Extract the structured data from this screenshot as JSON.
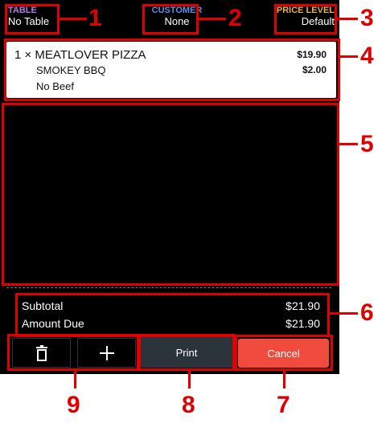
{
  "header": {
    "table_label": "TABLE",
    "table_value": "No Table",
    "customer_label": "CUSTOMER",
    "customer_value": "None",
    "price_level_label": "PRICE LEVEL",
    "price_level_value": "Default"
  },
  "order": {
    "item_qty_name": "1 × MEATLOVER PIZZA",
    "item_price": "$19.90",
    "modifier_1": "SMOKEY BBQ",
    "modifier_1_price": "$2.00",
    "modifier_2": "No Beef"
  },
  "totals": {
    "subtotal_label": "Subtotal",
    "subtotal_value": "$21.90",
    "amount_due_label": "Amount Due",
    "amount_due_value": "$21.90"
  },
  "buttons": {
    "print_label": "Print",
    "cancel_label": "Cancel",
    "delete_icon": "trash-icon",
    "add_icon": "plus-icon"
  },
  "callouts": [
    "1",
    "2",
    "3",
    "4",
    "5",
    "6",
    "7",
    "8",
    "9"
  ],
  "colors": {
    "table_label": "#b07ce8",
    "customer_label": "#5b8fe6",
    "price_level_label": "#e8b050",
    "annotation": "#e00000",
    "cancel": "#f04b3c",
    "print_bg": "#2b333b"
  }
}
